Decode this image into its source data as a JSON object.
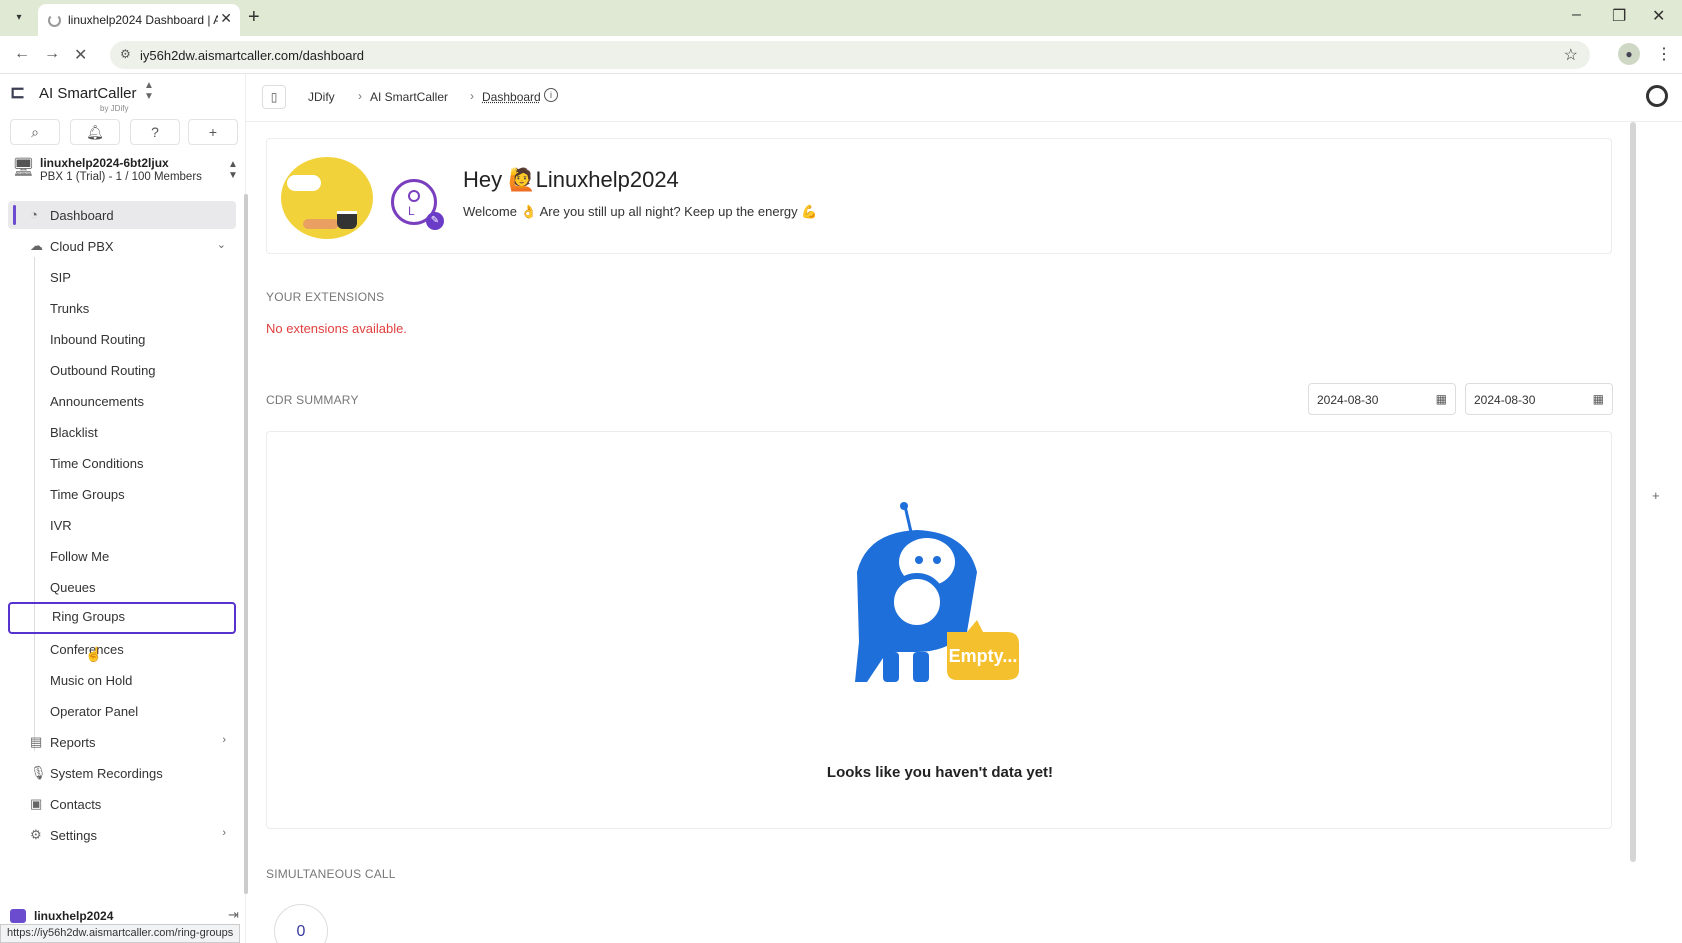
{
  "browser": {
    "tab_title": "linuxhelp2024 Dashboard | AI S...",
    "url": "iy56h2dw.aismartcaller.com/dashboard",
    "status_url": "https://iy56h2dw.aismartcaller.com/ring-groups"
  },
  "sidebar": {
    "brand_name": "AI SmartCaller",
    "brand_by": "by JDify",
    "org_name": "linuxhelp2024-6bt2ljux",
    "org_sub": "PBX 1 (Trial) - 1 / 100 Members",
    "items": [
      {
        "label": "Dashboard",
        "icon": "dashboard-icon"
      },
      {
        "label": "Cloud PBX",
        "icon": "cloud-icon"
      },
      {
        "label": "SIP"
      },
      {
        "label": "Trunks"
      },
      {
        "label": "Inbound Routing"
      },
      {
        "label": "Outbound Routing"
      },
      {
        "label": "Announcements"
      },
      {
        "label": "Blacklist"
      },
      {
        "label": "Time Conditions"
      },
      {
        "label": "Time Groups"
      },
      {
        "label": "IVR"
      },
      {
        "label": "Follow Me"
      },
      {
        "label": "Queues"
      },
      {
        "label": "Ring Groups"
      },
      {
        "label": "Conferences"
      },
      {
        "label": "Music on Hold"
      },
      {
        "label": "Operator Panel"
      },
      {
        "label": "Reports",
        "icon": "reports-icon"
      },
      {
        "label": "System Recordings",
        "icon": "microphone-icon"
      },
      {
        "label": "Contacts",
        "icon": "contacts-icon"
      },
      {
        "label": "Settings",
        "icon": "gear-icon"
      }
    ],
    "user_name": "linuxhelp2024"
  },
  "breadcrumb": {
    "items": [
      "JDify",
      "AI SmartCaller",
      "Dashboard"
    ]
  },
  "welcome": {
    "greeting_prefix": "Hey",
    "user": "Linuxhelp2024",
    "message": "Welcome 👌 Are you still up all night? Keep up the energy 💪",
    "avatar_letter": "L"
  },
  "extensions": {
    "title": "YOUR EXTENSIONS",
    "empty_message": "No extensions available."
  },
  "cdr": {
    "title": "CDR SUMMARY",
    "date_from": "2024-08-30",
    "date_to": "2024-08-30",
    "empty_badge": "Empty...",
    "empty_message": "Looks like you haven't data yet!"
  },
  "simultaneous": {
    "title": "SIMULTANEOUS CALL",
    "value": "0"
  }
}
